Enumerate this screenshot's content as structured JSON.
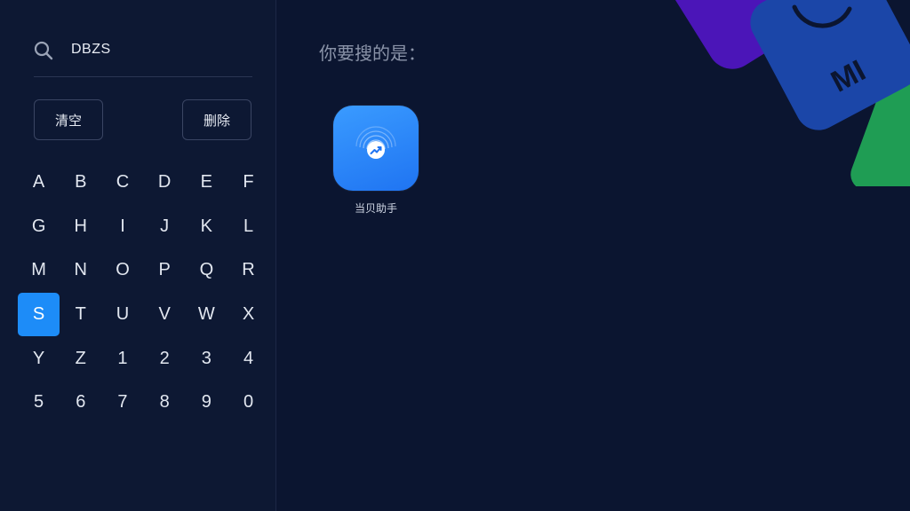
{
  "search": {
    "query": "DBZS",
    "clear_label": "清空",
    "delete_label": "删除"
  },
  "keyboard": {
    "keys": [
      "A",
      "B",
      "C",
      "D",
      "E",
      "F",
      "G",
      "H",
      "I",
      "J",
      "K",
      "L",
      "M",
      "N",
      "O",
      "P",
      "Q",
      "R",
      "S",
      "T",
      "U",
      "V",
      "W",
      "X",
      "Y",
      "Z",
      "1",
      "2",
      "3",
      "4",
      "5",
      "6",
      "7",
      "8",
      "9",
      "0"
    ],
    "selected": "S"
  },
  "results": {
    "title": "你要搜的是：",
    "apps": [
      {
        "name": "当贝助手",
        "icon": "dangbei-assistant-icon"
      }
    ]
  },
  "decor": {
    "brand_text": "MI"
  },
  "colors": {
    "background": "#0b1530",
    "panel": "#0d1833",
    "accent": "#1d8cf8",
    "app_icon": "#2a86fa"
  }
}
